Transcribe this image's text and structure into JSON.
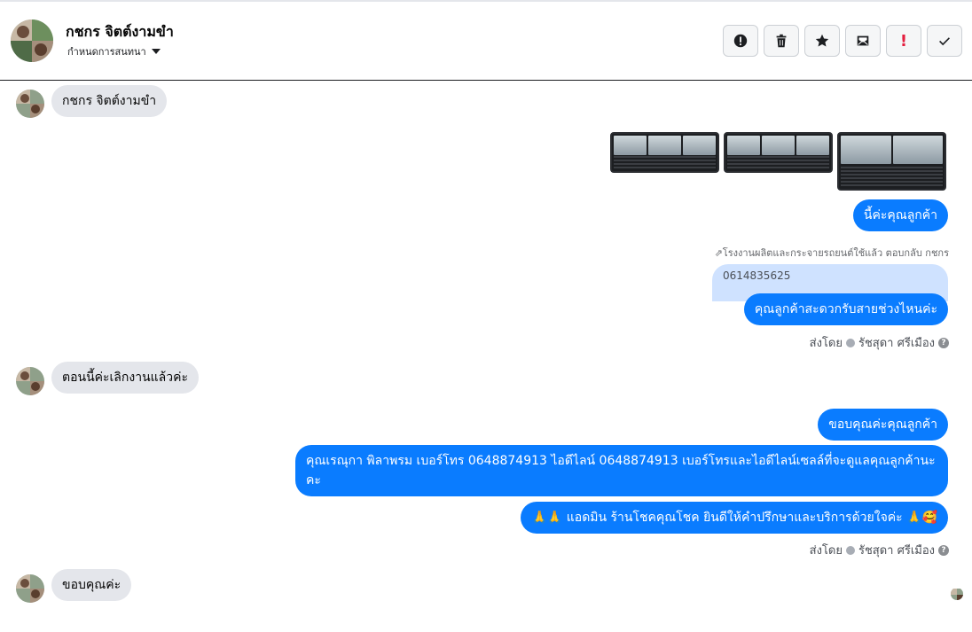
{
  "header": {
    "contact_name": "กชกร จิตต์งามขำ",
    "subtitle": "กำหนดการสนทนา",
    "actions": [
      {
        "icon": "spam-alert-icon"
      },
      {
        "icon": "trash-icon"
      },
      {
        "icon": "star-icon"
      },
      {
        "icon": "mark-unread-icon"
      },
      {
        "icon": "follow-up-icon",
        "text": "!"
      },
      {
        "icon": "check-icon"
      }
    ]
  },
  "messages": {
    "in1": "กชกร จิตต์งามขำ",
    "out1": "นี้ค่ะคุณลูกค้า",
    "reply_note": "โรงงานผลิตและกระจายรถยนต์ใช้แล้ว ตอบกลับ กชกร",
    "quoted": "0614835625",
    "out2": "คุณลูกค้าสะดวกรับสายช่วงไหนค่ะ",
    "sent_by_label": "ส่งโดย",
    "sent_by_name": "รัชสุดา ศรีเมือง",
    "in2": "ตอนนี้ค่ะเลิกงานแล้วค่ะ",
    "out3": "ขอบคุณค่ะคุณลูกค้า",
    "out4": "คุณเรณุกา พิลาพรม        เบอร์โทร 0648874913  ไอดีไลน์ 0648874913   เบอร์โทรและไอดีไลน์เซลล์ที่จะดูแลคุณลูกค้านะคะ",
    "out5_prefix": "🙏🙏",
    "out5_text": "แอดมิน ร้านโชคคุณโชค ยินดีให้คำปรึกษาและบริการด้วยใจค่ะ",
    "out5_suffix": "🙏🥰",
    "sent_by2_label": "ส่งโดย",
    "sent_by2_name": "รัชสุดา ศรีเมือง",
    "in3": "ขอบคุณค่ะ"
  },
  "colors": {
    "outgoing": "#0a7cff",
    "incoming": "#e4e6eb",
    "quote": "#cfe2ff",
    "follow_up": "#e41e3f"
  }
}
